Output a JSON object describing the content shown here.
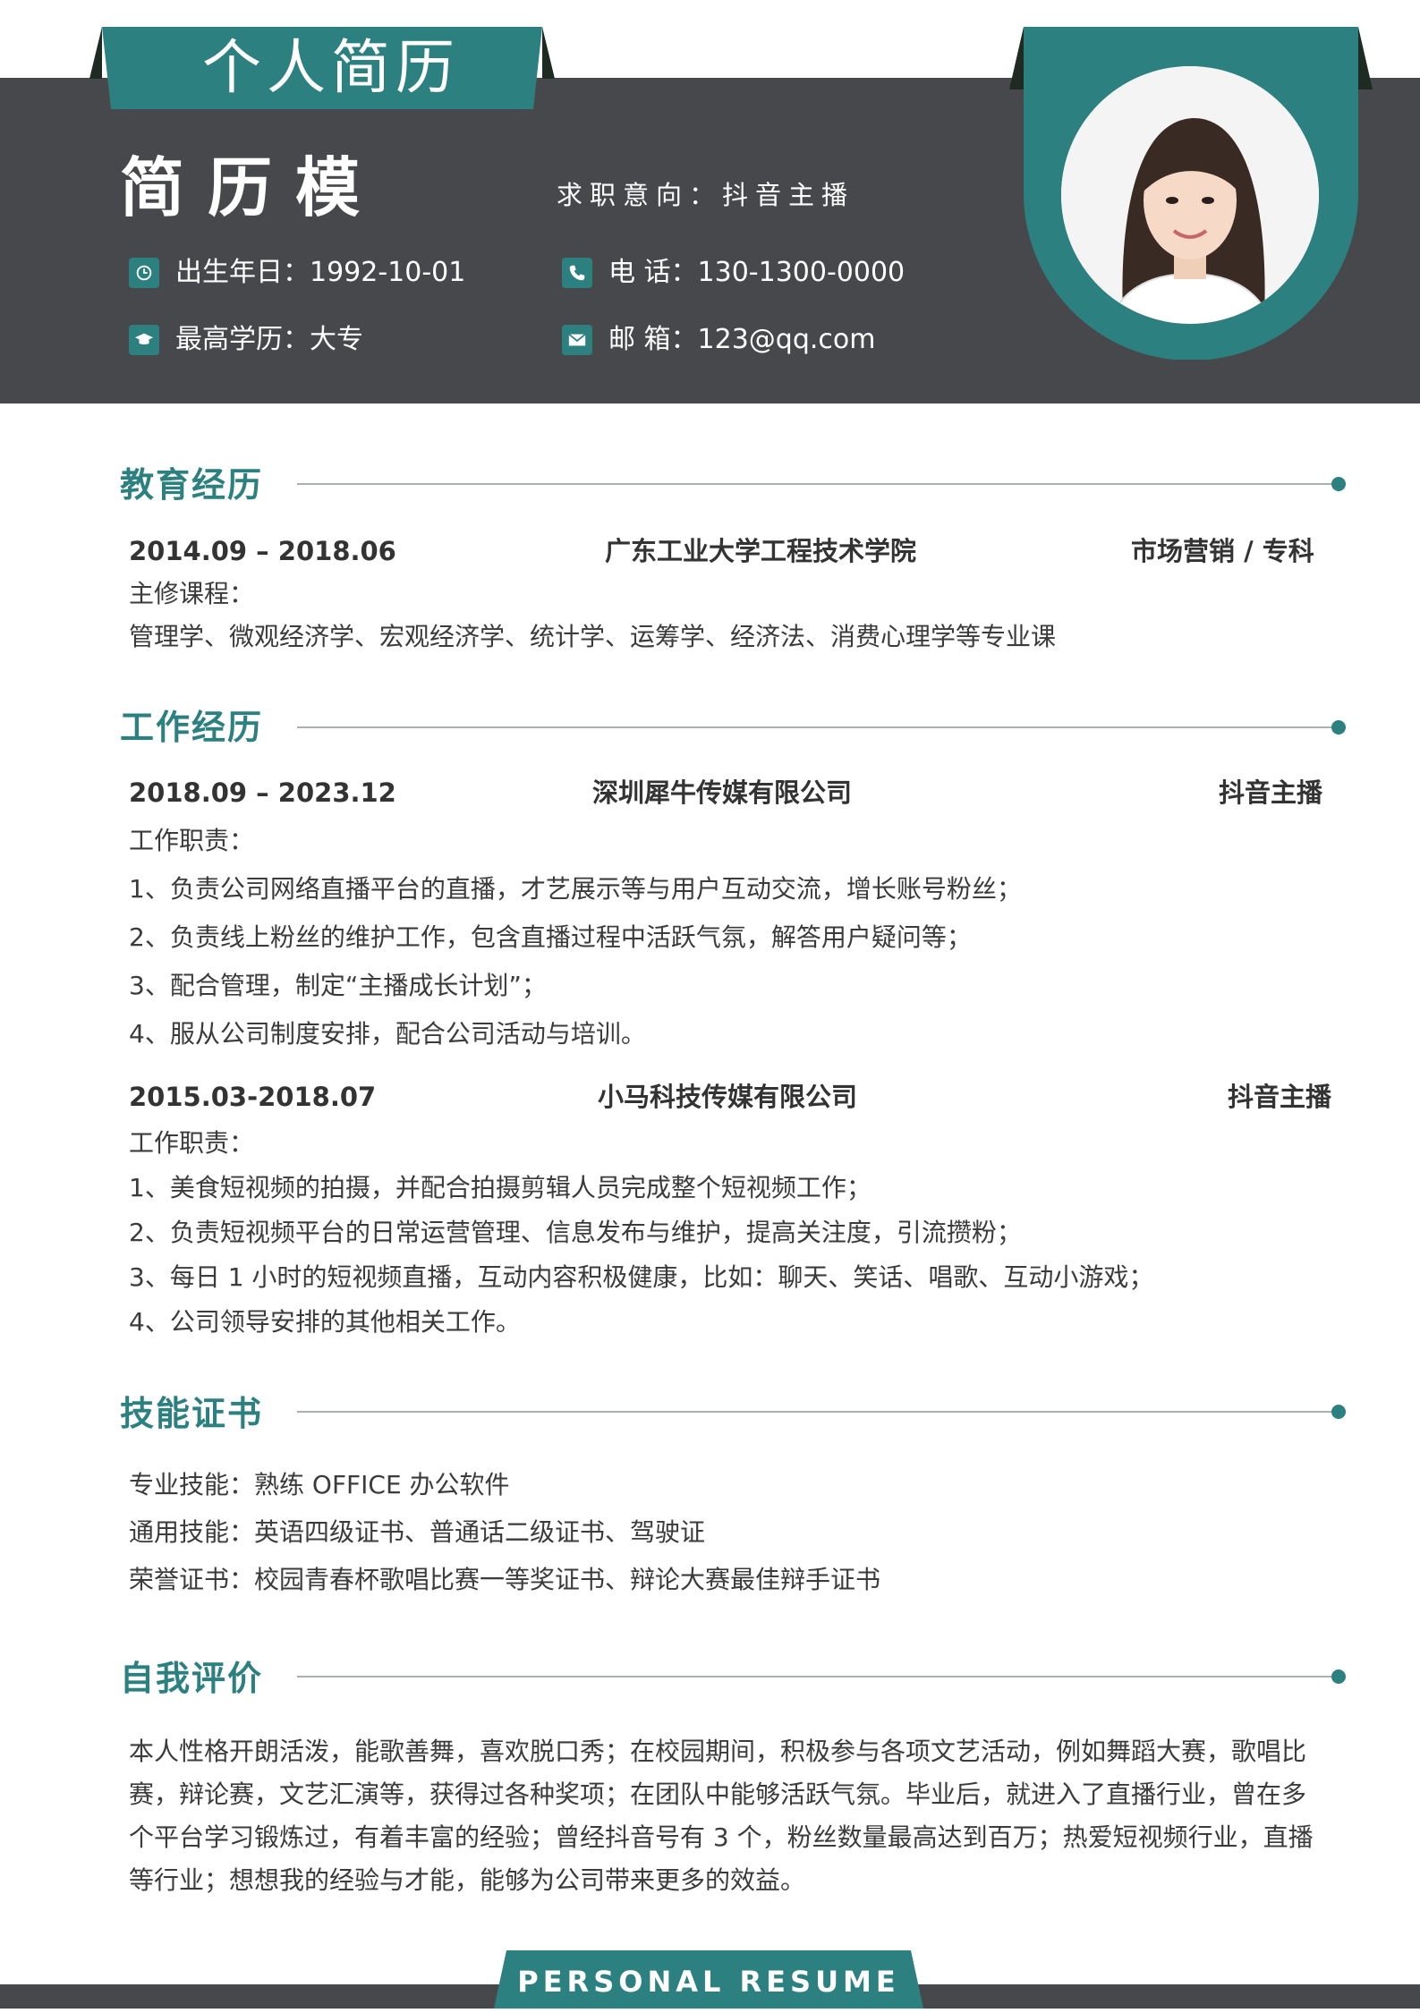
{
  "header": {
    "title": "个人简历",
    "name": "简历模",
    "objective": "求职意向：抖音主播",
    "birth": "出生年日：1992-10-01",
    "education": "最高学历：大专",
    "phone": "电  话：130-1300-0000",
    "email": "邮  箱：123@qq.com"
  },
  "sections": {
    "education": {
      "title": "教育经历",
      "period": "2014.09 – 2018.06",
      "school": "广东工业大学工程技术学院",
      "major": "市场营销 / 专科",
      "courses_label": "主修课程：",
      "courses": "管理学、微观经济学、宏观经济学、统计学、运筹学、经济法、消费心理学等专业课"
    },
    "work": {
      "title": "工作经历",
      "jobs": [
        {
          "period": "2018.09 – 2023.12",
          "company": "深圳犀牛传媒有限公司",
          "position": "抖音主播",
          "duty_label": "工作职责：",
          "duties": [
            "1、负责公司网络直播平台的直播，才艺展示等与用户互动交流，增长账号粉丝；",
            "2、负责线上粉丝的维护工作，包含直播过程中活跃气氛，解答用户疑问等；",
            "3、配合管理，制定“主播成长计划”；",
            "4、服从公司制度安排，配合公司活动与培训。"
          ]
        },
        {
          "period": "2015.03-2018.07",
          "company": "小马科技传媒有限公司",
          "position": "抖音主播",
          "duty_label": "工作职责：",
          "duties": [
            "1、美食短视频的拍摄，并配合拍摄剪辑人员完成整个短视频工作；",
            "2、负责短视频平台的日常运营管理、信息发布与维护，提高关注度，引流攒粉；",
            "3、每日 1 小时的短视频直播，互动内容积极健康，比如：聊天、笑话、唱歌、互动小游戏；",
            "4、公司领导安排的其他相关工作。"
          ]
        }
      ]
    },
    "skills": {
      "title": "技能证书",
      "items": [
        "专业技能：熟练 OFFICE 办公软件",
        "通用技能：英语四级证书、普通话二级证书、驾驶证",
        "荣誉证书：校园青春杯歌唱比赛一等奖证书、辩论大赛最佳辩手证书"
      ]
    },
    "self": {
      "title": "自我评价",
      "text": "本人性格开朗活泼，能歌善舞，喜欢脱口秀；在校园期间，积极参与各项文艺活动，例如舞蹈大赛，歌唱比赛，辩论赛，文艺汇演等，获得过各种奖项；在团队中能够活跃气氛。毕业后，就进入了直播行业，曾在多个平台学习锻炼过，有着丰富的经验；曾经抖音号有 3 个，粉丝数量最高达到百万；热爱短视频行业，直播等行业；想想我的经验与才能，能够为公司带来更多的效益。"
    }
  },
  "footer": {
    "label": "PERSONAL RESUME"
  },
  "colors": {
    "accent": "#2d8080",
    "dark": "#47484b",
    "text": "#333333"
  },
  "icons": {
    "birth": "clock-icon",
    "education": "graduation-cap-icon",
    "phone": "phone-icon",
    "email": "envelope-icon"
  }
}
